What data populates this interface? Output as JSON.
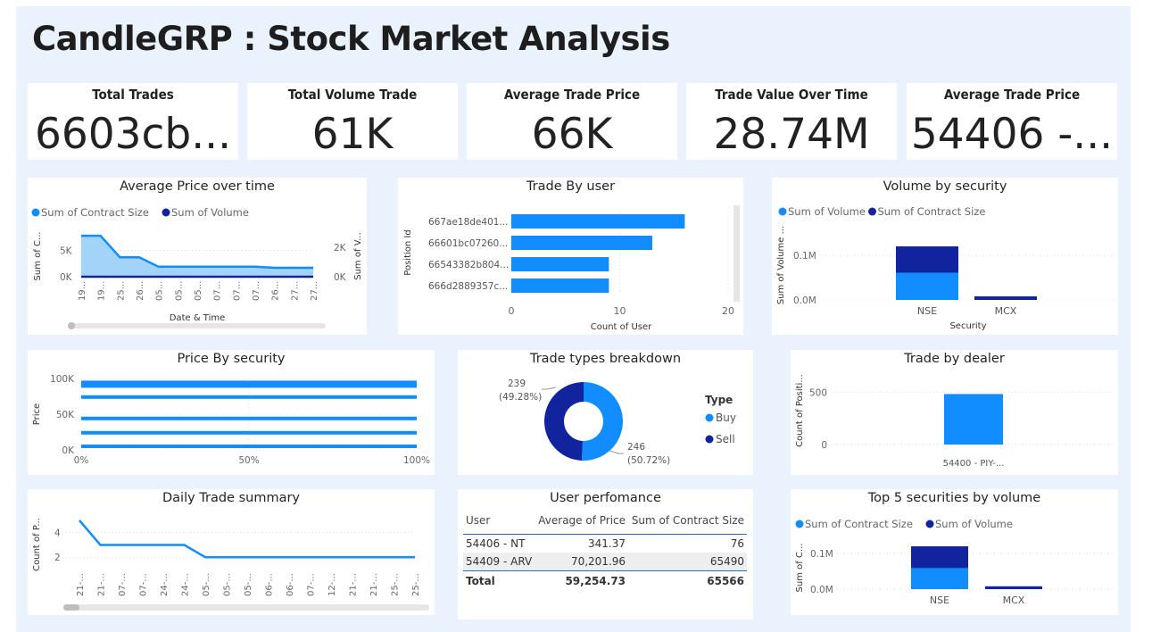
{
  "page": {
    "title": "CandleGRP : Stock Market Analysis"
  },
  "colors": {
    "light_blue": "#118DFF",
    "dark_blue": "#12239E",
    "area_fill": "#9ACEFA",
    "canvas": "#EAF3FD"
  },
  "cards": [
    {
      "title": "Total Trades",
      "value": "6603cb..."
    },
    {
      "title": "Total Volume Trade",
      "value": "61K"
    },
    {
      "title": "Average Trade Price",
      "value": "66K"
    },
    {
      "title": "Trade Value Over Time",
      "value": "28.74M"
    },
    {
      "title": "Average Trade Price",
      "value": "54406 -..."
    }
  ],
  "chart_data": [
    {
      "id": "avg_price_over_time",
      "type": "area",
      "title": "Average Price over time",
      "legend": [
        "Sum of Contract Size",
        "Sum of Volume"
      ],
      "xlabel": "Date & Time",
      "ylabel_left": "Sum of C...",
      "ylabel_right": "Sum of V...",
      "x": [
        "19...",
        "19...",
        "25...",
        "26...",
        "05...",
        "05...",
        "05...",
        "07...",
        "07...",
        "07...",
        "26...",
        "27...",
        "27..."
      ],
      "series": [
        {
          "name": "Sum of Contract Size",
          "values": [
            7800,
            7800,
            3700,
            3700,
            1900,
            1900,
            1900,
            1900,
            1900,
            1900,
            1700,
            1700,
            1700
          ]
        },
        {
          "name": "Sum of Volume",
          "values": [
            0,
            0,
            0,
            0,
            0,
            0,
            0,
            0,
            0,
            0,
            0,
            0,
            0
          ]
        }
      ],
      "yticks_left": [
        "5K",
        "0K"
      ],
      "yticks_right": [
        "2K",
        "0K"
      ],
      "ylim_left": [
        0,
        9000
      ]
    },
    {
      "id": "trade_by_user",
      "type": "bar",
      "orientation": "horizontal",
      "title": "Trade By user",
      "ylabel": "Position Id",
      "xlabel": "Count of User",
      "categories": [
        "667ae18de401...",
        "66601bc07260...",
        "66543382b804...",
        "666d2889357c..."
      ],
      "values": [
        16,
        13,
        9,
        9
      ],
      "xticks": [
        "0",
        "10",
        "20"
      ],
      "xlim": [
        0,
        20
      ]
    },
    {
      "id": "volume_by_security",
      "type": "bar",
      "stacked": true,
      "title": "Volume by security",
      "legend": [
        "Sum of Volume",
        "Sum of Contract Size"
      ],
      "xlabel": "Security",
      "ylabel": "Sum of Volume ...",
      "categories": [
        "NSE",
        "MCX"
      ],
      "series": [
        {
          "name": "Sum of Volume",
          "values": [
            0.061,
            0.0
          ]
        },
        {
          "name": "Sum of Contract Size",
          "values": [
            0.059,
            0.008
          ]
        }
      ],
      "yticks": [
        "0.1M",
        "0.0M"
      ],
      "ylim": [
        0,
        0.13
      ]
    },
    {
      "id": "price_by_security",
      "type": "bar",
      "orientation": "horizontal",
      "title": "Price By security",
      "ylabel": "Price",
      "categories_y": [
        92000,
        74000,
        44000,
        24000,
        5000
      ],
      "values": [
        100,
        100,
        100,
        100,
        100
      ],
      "yticks": [
        "100K",
        "50K",
        "0K"
      ],
      "xticks": [
        "0%",
        "50%",
        "100%"
      ],
      "ylim": [
        0,
        100000
      ]
    },
    {
      "id": "trade_types_breakdown",
      "type": "pie",
      "title": "Trade types breakdown",
      "legend_title": "Type",
      "labels": [
        "Buy",
        "Sell"
      ],
      "values": [
        246,
        239
      ],
      "data_labels": [
        {
          "count": "246",
          "pct": "(50.72%)"
        },
        {
          "count": "239",
          "pct": "(49.28%)"
        }
      ]
    },
    {
      "id": "trade_by_dealer",
      "type": "bar",
      "title": "Trade by dealer",
      "ylabel": "Count of Positi...",
      "categories": [
        "54400 - PIY-..."
      ],
      "values": [
        485
      ],
      "yticks": [
        "500",
        "0"
      ],
      "ylim": [
        0,
        600
      ]
    },
    {
      "id": "daily_trade_summary",
      "type": "line",
      "title": "Daily Trade summary",
      "ylabel": "Count of P...",
      "x": [
        "21-...",
        "21-...",
        "07-...",
        "07-...",
        "24-...",
        "24-...",
        "05-...",
        "05-...",
        "05-...",
        "06-...",
        "06-...",
        "07-...",
        "12-...",
        "21-...",
        "21-...",
        "25-...",
        "25-..."
      ],
      "values": [
        5,
        3,
        3,
        3,
        3,
        3,
        2,
        2,
        2,
        2,
        2,
        2,
        2,
        2,
        2,
        2,
        2
      ],
      "yticks": [
        "4",
        "2"
      ],
      "ylim": [
        1,
        5.5
      ]
    },
    {
      "id": "top5_securities",
      "type": "bar",
      "stacked": true,
      "title": "Top 5 securities by volume",
      "legend": [
        "Sum of Contract Size",
        "Sum of Volume"
      ],
      "ylabel": "Sum of C...",
      "categories": [
        "NSE",
        "MCX"
      ],
      "series": [
        {
          "name": "Sum of Contract Size",
          "values": [
            0.059,
            0.0
          ]
        },
        {
          "name": "Sum of Volume",
          "values": [
            0.061,
            0.008
          ]
        }
      ],
      "yticks": [
        "0.1M",
        "0.0M"
      ],
      "ylim": [
        0,
        0.13
      ]
    }
  ],
  "user_performance": {
    "title": "User perfomance",
    "columns": [
      "User",
      "Average of Price",
      "Sum of Contract Size"
    ],
    "rows": [
      [
        "54406 - NT",
        "341.37",
        "76"
      ],
      [
        "54409 - ARV",
        "70,201.96",
        "65490"
      ]
    ],
    "total": [
      "Total",
      "59,254.73",
      "65566"
    ]
  }
}
